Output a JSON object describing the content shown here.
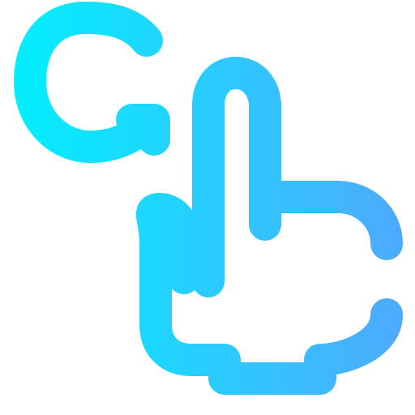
{
  "icon": {
    "name": "tap-gesture-icon",
    "parts": [
      "refresh-arrow-icon",
      "pointing-hand-icon"
    ]
  },
  "colors": {
    "gradient_start": "#00F1FF",
    "gradient_end": "#50A8FF",
    "background": "#FFFFFF"
  }
}
